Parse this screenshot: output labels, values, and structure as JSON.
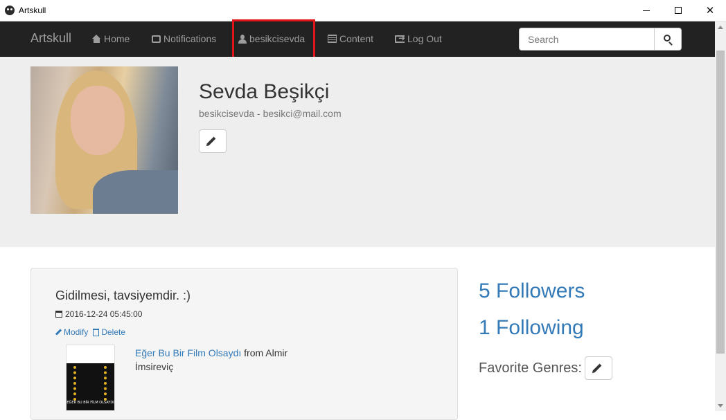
{
  "window": {
    "title": "Artskull",
    "minimize_icon": "minimize-icon",
    "maximize_icon": "maximize-icon",
    "close_icon": "close-icon"
  },
  "navbar": {
    "brand": "Artskull",
    "items": [
      {
        "label": "Home",
        "icon": "home-icon"
      },
      {
        "label": "Notifications",
        "icon": "inbox-icon"
      },
      {
        "label": "besikcisevda",
        "icon": "user-icon",
        "highlighted": true
      },
      {
        "label": "Content",
        "icon": "list-icon"
      },
      {
        "label": "Log Out",
        "icon": "logout-icon"
      }
    ],
    "search": {
      "placeholder": "Search",
      "icon": "search-icon"
    }
  },
  "colors": {
    "navbar_bg": "#222222",
    "link": "#337ab7",
    "highlight_border": "#e0151b",
    "jumbotron_bg": "#eeeeee"
  },
  "profile": {
    "name": "Sevda Beşikçi",
    "subtitle": "besikcisevda - besikci@mail.com",
    "edit_icon": "pencil-icon"
  },
  "post": {
    "title": "Gidilmesi, tavsiyemdir. :)",
    "date": "2016-12-24 05:45:00",
    "modify_label": "Modify",
    "delete_label": "Delete",
    "film_title": "Eğer Bu Bir Film Olsaydı",
    "film_from": " from Almir İmsireviç",
    "poster_caption": "EĞER BU BİR FİLM OLSAYDI"
  },
  "stats": {
    "followers": "5 Followers",
    "following": "1 Following",
    "favorite_genres_label": "Favorite Genres:"
  }
}
